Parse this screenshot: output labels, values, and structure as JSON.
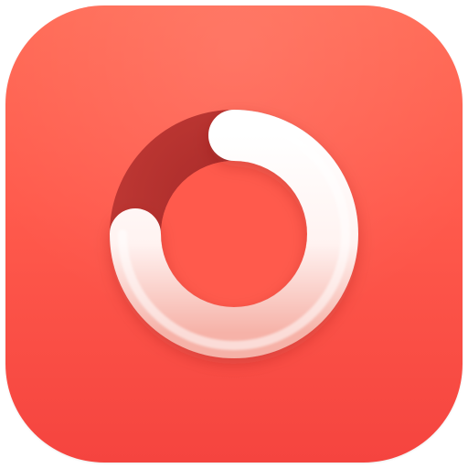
{
  "icon": {
    "name": "progress-ring-app-icon",
    "progress": 0.75,
    "colors": {
      "background_top": "#ff6a55",
      "background_bottom": "#f5443f",
      "track": "#b8302e",
      "ring_light": "#ffffff",
      "ring_shade": "#f7b6ad"
    }
  }
}
